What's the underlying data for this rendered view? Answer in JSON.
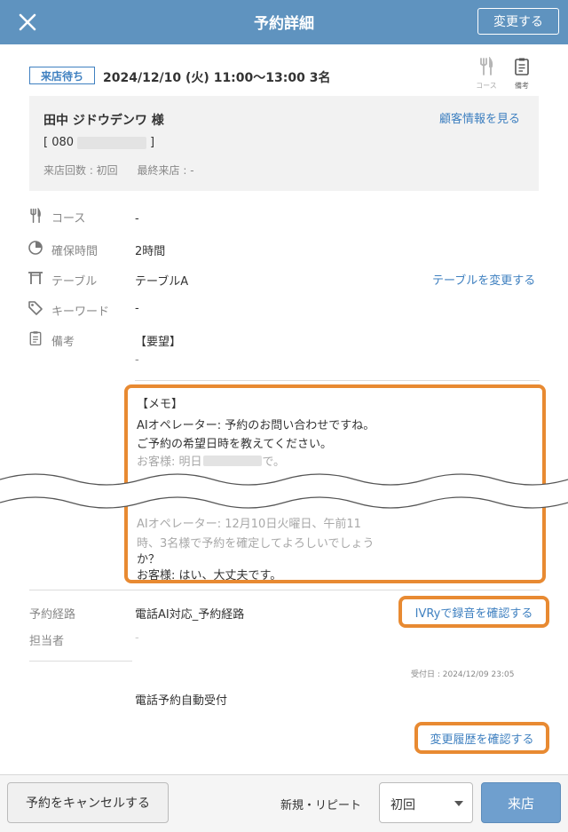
{
  "header": {
    "title": "予約詳細",
    "edit_label": "変更する"
  },
  "reservation": {
    "status": "来店待ち",
    "datetime": "2024/12/10 (火) 11:00〜13:00 3名",
    "icons": {
      "course_label": "コース",
      "memo_label": "備考"
    }
  },
  "customer": {
    "name": "田中 ジドウデンワ 様",
    "phone_prefix": "[ 080",
    "phone_suffix": "]",
    "visits": "来店回数 : 初回",
    "last_visit": "最終来店 : -",
    "link": "顧客情報を見る"
  },
  "details": {
    "course": {
      "label": "コース",
      "value": "-"
    },
    "duration": {
      "label": "確保時間",
      "value": "2時間"
    },
    "table": {
      "label": "テーブル",
      "value": "テーブルA",
      "link": "テーブルを変更する"
    },
    "keyword": {
      "label": "キーワード",
      "value": "-"
    },
    "notes": {
      "label": "備考",
      "request_header": "【要望】",
      "request_value": "-"
    }
  },
  "memo": {
    "header": "【メモ】",
    "line1": "AIオペレーター: 予約のお問い合わせですね。",
    "line2": "ご予約の希望日時を教えてください。",
    "line3_prefix": "お客様: 明日",
    "line3_suffix": "で。",
    "line4": "AIオペレーター: 12月10日火曜日、午前11",
    "line5": "時、3名様で予約を確定してよろしいでしょう",
    "line6": "か？",
    "line7": "お客様: はい、大丈夫です。"
  },
  "route": {
    "label": "予約経路",
    "value": "電話AI対応_予約経路",
    "recording_link": "IVRyで録音を確認する",
    "staff_label": "担当者",
    "staff_value": "-",
    "received": "受付日 : 2024/12/09 23:05",
    "auto": "電話予約自動受付",
    "history_link": "変更履歴を確認する"
  },
  "footer": {
    "cancel": "予約をキャンセルする",
    "new_repeat": "新規・リピート",
    "select_value": "初回",
    "arrive": "来店"
  }
}
